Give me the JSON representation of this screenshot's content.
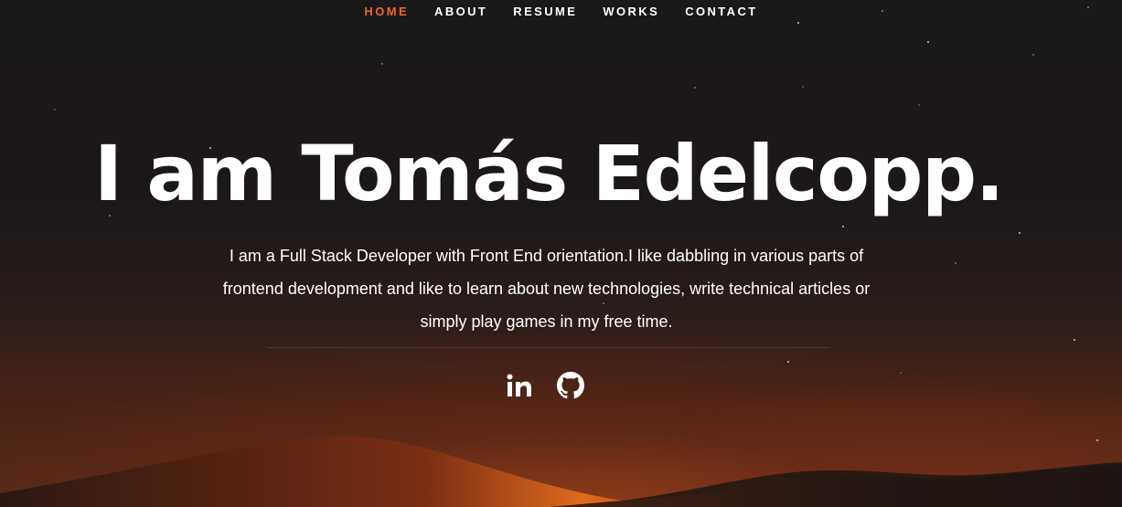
{
  "nav": {
    "items": [
      {
        "label": "HOME",
        "active": true
      },
      {
        "label": "ABOUT"
      },
      {
        "label": "RESUME"
      },
      {
        "label": "WORKS"
      },
      {
        "label": "CONTACT"
      }
    ]
  },
  "hero": {
    "headline": "I am Tomás Edelcopp.",
    "bio": "I am a Full Stack Developer with Front End orientation.I like dabbling in various parts of frontend development and like to learn about new technologies, write technical articles or simply play games in my free time."
  },
  "socials": [
    {
      "icon": "linkedin-icon"
    },
    {
      "icon": "github-icon"
    }
  ],
  "colors": {
    "accent": "#e8692a",
    "text": "#ffffff",
    "background": "#1a1718"
  }
}
